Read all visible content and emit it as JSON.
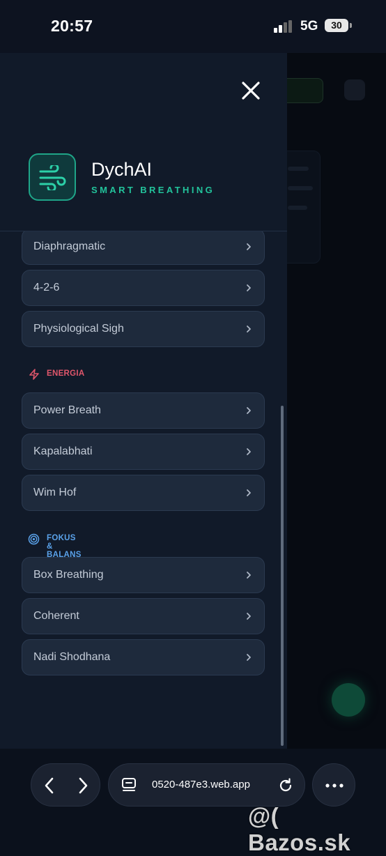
{
  "status_bar": {
    "time": "20:57",
    "network": "5G",
    "battery": "30"
  },
  "brand": {
    "name": "DychAI",
    "tagline": "SMART BREATHING",
    "accent": "#22c39b"
  },
  "menu": {
    "items_top": [
      "Diaphragmatic",
      "4-2-6",
      "Physiological Sigh"
    ],
    "sections": [
      {
        "title": "ENERGIA",
        "color": "#e0566b",
        "icon": "lightning-icon",
        "items": [
          "Power Breath",
          "Kapalabhati",
          "Wim Hof"
        ]
      },
      {
        "title": "FOKUS & BALANS",
        "color": "#5aa2ea",
        "icon": "target-icon",
        "items": [
          "Box Breathing",
          "Coherent",
          "Nadi Shodhana"
        ]
      }
    ]
  },
  "browser": {
    "url": "0520-487e3.web.app"
  },
  "watermark": "@( Bazos.sk"
}
